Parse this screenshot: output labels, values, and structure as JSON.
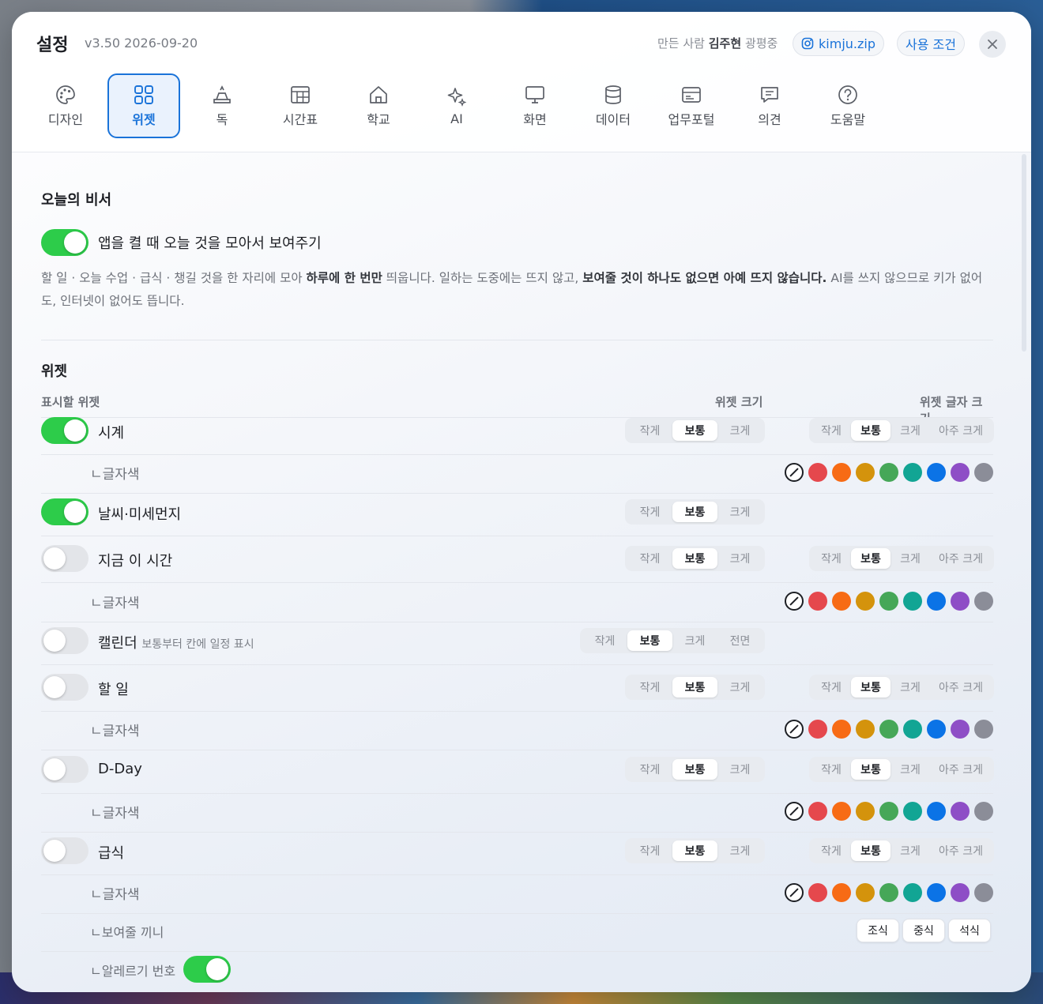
{
  "header": {
    "title": "설정",
    "version": "v3.50 2026-09-20",
    "maker_prefix": "만든 사람",
    "maker_name": "김주현",
    "maker_suffix": "광평중",
    "instagram": "kimju.zip",
    "terms": "사용 조건"
  },
  "tabs": [
    {
      "label": "디자인",
      "icon": "palette-icon"
    },
    {
      "label": "위젯",
      "icon": "widgets-grid-icon",
      "active": true
    },
    {
      "label": "독",
      "icon": "dock-icon"
    },
    {
      "label": "시간표",
      "icon": "timetable-icon"
    },
    {
      "label": "학교",
      "icon": "school-icon"
    },
    {
      "label": "AI",
      "icon": "sparkle-icon"
    },
    {
      "label": "화면",
      "icon": "monitor-icon"
    },
    {
      "label": "데이터",
      "icon": "database-icon"
    },
    {
      "label": "업무포털",
      "icon": "portal-card-icon"
    },
    {
      "label": "의견",
      "icon": "feedback-icon"
    },
    {
      "label": "도움말",
      "icon": "help-icon"
    }
  ],
  "secretary": {
    "title": "오늘의 비서",
    "toggle_label": "앱을 켤 때 오늘 것을 모아서 보여주기",
    "toggle_on": true,
    "desc_part1": "할 일 · 오늘 수업 · 급식 · 챙길 것을 한 자리에 모아 ",
    "desc_bold1": "하루에 한 번만",
    "desc_part2": " 띄웁니다. 일하는 도중에는 뜨지 않고, ",
    "desc_bold2": "보여줄 것이 하나도 없으면 아예 뜨지 않습니다.",
    "desc_part3": " AI를 쓰지 않으므로 키가 없어도, 인터넷이 없어도 뜹니다."
  },
  "widgets": {
    "title": "위젯",
    "col_show": "표시할 위젯",
    "col_size": "위젯 크기",
    "col_font": "위젯 글자 크기",
    "size_options": [
      "작게",
      "보통",
      "크게"
    ],
    "calendar_size_options": [
      "작게",
      "보통",
      "크게",
      "전면"
    ],
    "font_options": [
      "작게",
      "보통",
      "크게",
      "아주 크게"
    ],
    "selected_size": "보통",
    "selected_font": "보통",
    "text_color_label": "ㄴ글자색",
    "items": [
      {
        "name": "시계",
        "on": true
      },
      {
        "name": "날씨·미세먼지",
        "on": true
      },
      {
        "name": "지금 이 시간",
        "on": false
      },
      {
        "name": "캘린더",
        "note": "보통부터 칸에 일정 표시",
        "on": false
      },
      {
        "name": "할 일",
        "on": false
      },
      {
        "name": "D-Day",
        "on": false
      },
      {
        "name": "급식",
        "on": false
      }
    ],
    "meal_label": "ㄴ보여줄 끼니",
    "meal_options": [
      "조식",
      "중식",
      "석식"
    ],
    "allergy_label": "ㄴ알레르기 번호",
    "allergy_on": true
  },
  "colors": {
    "accent": "#1a73d9",
    "toggle_on": "#2dcc4a",
    "swatches": [
      "#e5484d",
      "#f76b15",
      "#d4930c",
      "#46a758",
      "#12a594",
      "#0b73e6",
      "#8e4ec6",
      "#8b8d98"
    ]
  }
}
